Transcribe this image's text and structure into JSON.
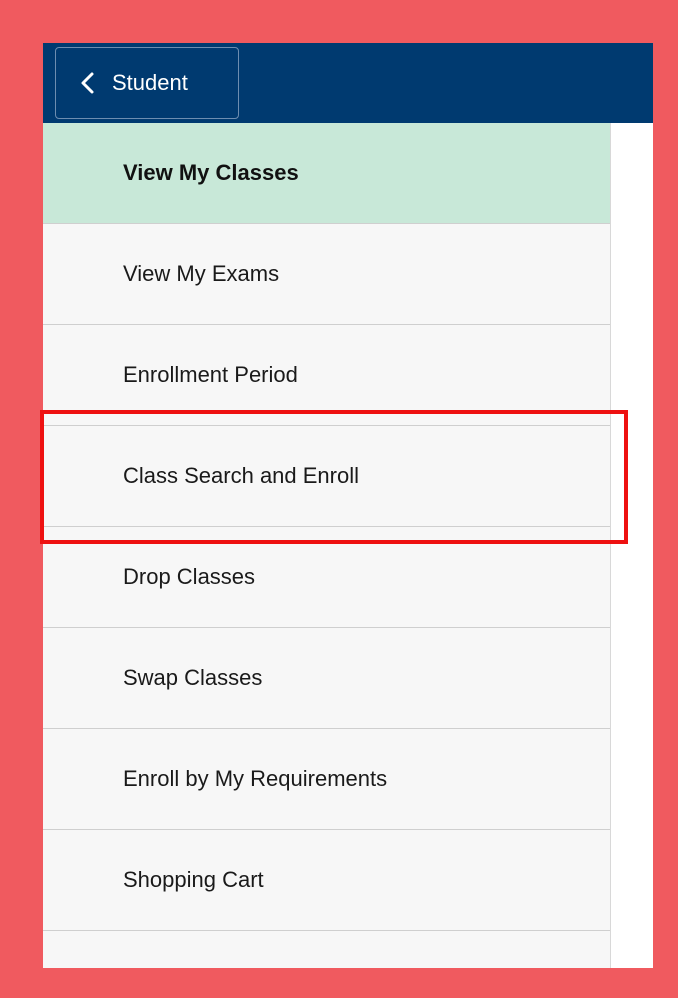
{
  "header": {
    "back_label": "Student"
  },
  "menu": {
    "items": [
      {
        "label": "View My Classes",
        "active": true
      },
      {
        "label": "View My Exams"
      },
      {
        "label": "Enrollment Period"
      },
      {
        "label": "Class Search and Enroll"
      },
      {
        "label": "Drop Classes"
      },
      {
        "label": "Swap Classes"
      },
      {
        "label": "Enroll by My Requirements"
      },
      {
        "label": "Shopping Cart"
      },
      {
        "label": ""
      }
    ]
  },
  "colors": {
    "frame": "#f05a5f",
    "topbar": "#003a70",
    "active_item": "#c8e8d8",
    "menu_bg": "#f7f7f7",
    "highlight": "#ee1111"
  },
  "icons": {
    "back": "chevron-left-icon"
  }
}
